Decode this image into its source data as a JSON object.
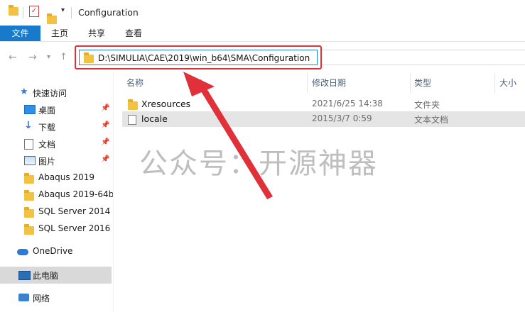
{
  "window": {
    "title": "Configuration"
  },
  "ribbon": {
    "tabs": [
      {
        "label": "文件"
      },
      {
        "label": "主页"
      },
      {
        "label": "共享"
      },
      {
        "label": "查看"
      }
    ]
  },
  "address_bar": {
    "path": "D:\\SIMULIA\\CAE\\2019\\win_b64\\SMA\\Configuration"
  },
  "sidebar": {
    "quick_access": "快速访问",
    "items": [
      {
        "label": "桌面",
        "icon": "desktop-icon",
        "pinned": true
      },
      {
        "label": "下载",
        "icon": "download-icon",
        "pinned": true
      },
      {
        "label": "文档",
        "icon": "document-icon",
        "pinned": true
      },
      {
        "label": "图片",
        "icon": "pictures-icon",
        "pinned": true
      },
      {
        "label": "Abaqus 2019",
        "icon": "folder-icon",
        "pinned": false
      },
      {
        "label": "Abaqus 2019-64b",
        "icon": "folder-icon",
        "pinned": false
      },
      {
        "label": "SQL Server 2014",
        "icon": "folder-icon",
        "pinned": false
      },
      {
        "label": "SQL Server 2016",
        "icon": "folder-icon",
        "pinned": false
      }
    ],
    "onedrive": "OneDrive",
    "this_pc": "此电脑",
    "network": "网络"
  },
  "columns": {
    "name": "名称",
    "date": "修改日期",
    "type": "类型",
    "size": "大小"
  },
  "files": [
    {
      "name": "Xresources",
      "date": "2021/6/25 14:38",
      "type": "文件夹",
      "icon": "folder-icon"
    },
    {
      "name": "locale",
      "date": "2015/3/7 0:59",
      "type": "文本文档",
      "icon": "text-file-icon"
    }
  ],
  "watermark": "公众号：开源神器",
  "colors": {
    "file_tab": "#1979ca",
    "highlight_box": "#e0303a",
    "arrow": "#e0303a"
  }
}
